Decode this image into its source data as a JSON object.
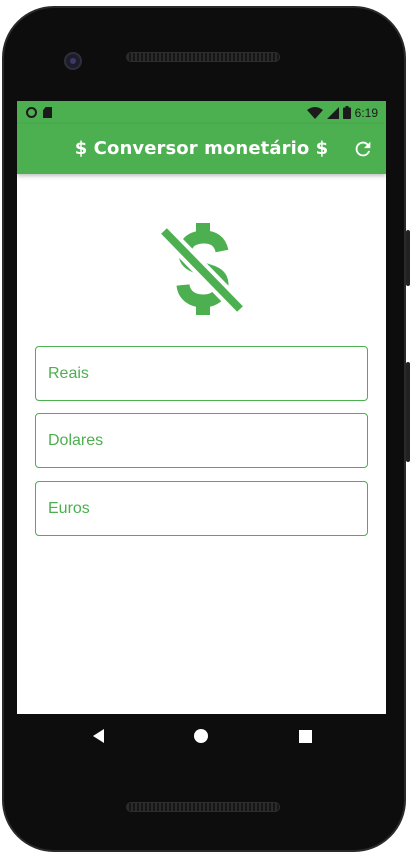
{
  "status_bar": {
    "time": "6:19"
  },
  "app_bar": {
    "title": "$ Conversor monetário $"
  },
  "form": {
    "reais_placeholder": "Reais",
    "dolares_placeholder": "Dolares",
    "euros_placeholder": "Euros"
  },
  "icons": {
    "main": "money-off-icon",
    "action": "refresh-icon",
    "nav": [
      "back-icon",
      "home-icon",
      "recents-icon"
    ]
  },
  "colors": {
    "primary": "#4caf50",
    "bezel": "#0d0d0d",
    "screen": "#ffffff"
  }
}
